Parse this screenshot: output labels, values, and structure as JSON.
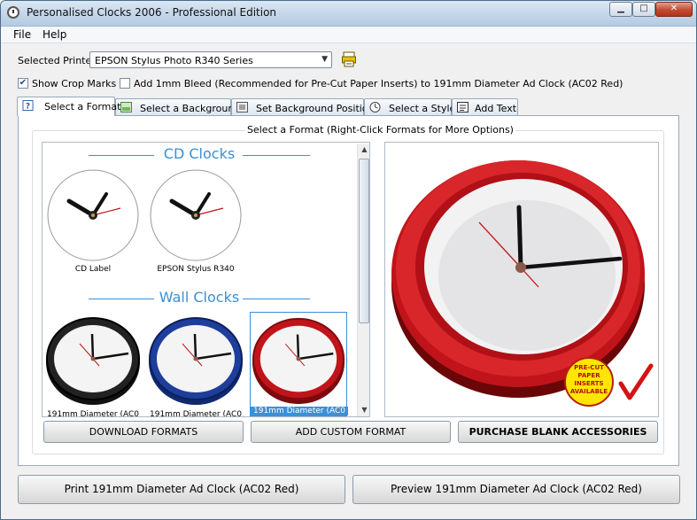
{
  "window": {
    "title": "Personalised Clocks 2006 - Professional Edition",
    "btn_min": "▁",
    "btn_max": "□",
    "btn_close": "✕"
  },
  "menu": [
    "File",
    "Help"
  ],
  "printer": {
    "label": "Selected Printer",
    "value": "EPSON Stylus Photo R340 Series"
  },
  "options": {
    "crop_marks": {
      "label": "Show Crop Marks",
      "checked": true
    },
    "bleed": {
      "label": "Add 1mm Bleed (Recommended for Pre-Cut Paper Inserts) to 191mm Diameter Ad Clock (AC02 Red)",
      "checked": false
    }
  },
  "tabs": [
    {
      "label": "Select a Format",
      "icon": "help-icon",
      "active": true
    },
    {
      "label": "Select a Background",
      "icon": "background-icon"
    },
    {
      "label": "Set Background Position",
      "icon": "position-icon"
    },
    {
      "label": "Select a Style",
      "icon": "style-icon"
    },
    {
      "label": "Add Text",
      "icon": "text-icon"
    }
  ],
  "panel": {
    "group_title": "Select a Format (Right-Click Formats for More Options)",
    "sections": [
      {
        "title": "CD Clocks",
        "items": [
          "CD Label",
          "EPSON Stylus R340"
        ]
      },
      {
        "title": "Wall Clocks",
        "items": [
          "191mm Diameter (AC0",
          "191mm Diameter (AC0",
          "191mm Diameter (AC0"
        ]
      }
    ],
    "preview_badge": [
      "PRE-CUT",
      "PAPER",
      "INSERTS",
      "AVAILABLE"
    ],
    "buttons": {
      "download": "DOWNLOAD FORMATS",
      "custom": "ADD CUSTOM FORMAT",
      "purchase": "PURCHASE BLANK ACCESSORIES"
    }
  },
  "footer": {
    "print": "Print 191mm Diameter Ad Clock (AC02 Red)",
    "preview": "Preview 191mm Diameter Ad Clock (AC02 Red)"
  },
  "colors": {
    "accent": "#3a8fd4",
    "clock_red": "#c0141a",
    "clock_blue": "#1e3e9c",
    "clock_black": "#111111",
    "badge_yellow": "#ffe600"
  }
}
